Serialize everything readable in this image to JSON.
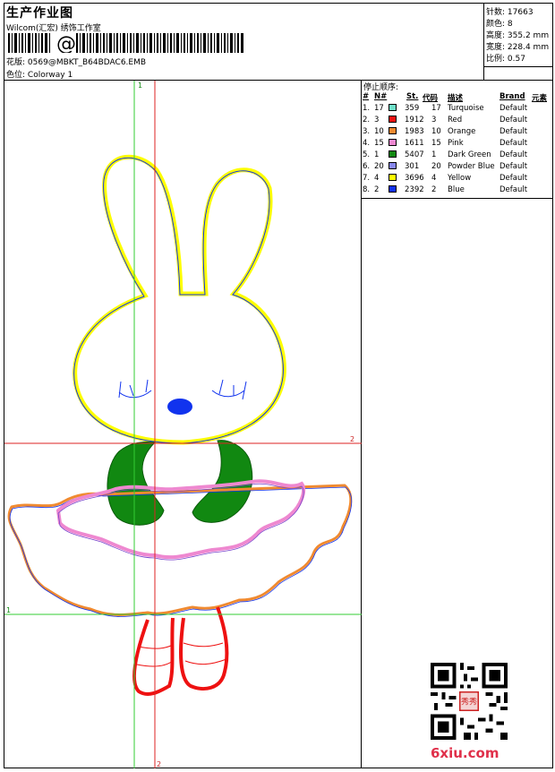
{
  "header": {
    "title": "生产作业图",
    "company": "Wilcom(汇宏) 绣饰工作室",
    "barcode_text": "@",
    "design_label": "花版:",
    "design_value": "0569@MBKT_B64BDAC6.EMB",
    "colorway_label": "色位:",
    "colorway_value": "Colorway 1"
  },
  "stats": {
    "stitches_label": "针数:",
    "stitches_value": "17663",
    "colors_label": "颜色:",
    "colors_value": "8",
    "height_label": "高度:",
    "height_value": "355.2 mm",
    "width_label": "宽度:",
    "width_value": "228.4 mm",
    "scale_label": "比例:",
    "scale_value": "0.57"
  },
  "guides": {
    "v1": "1",
    "v2": "2",
    "h1": "1",
    "h2": "2"
  },
  "stop_sequence": {
    "title": "停止顺序:",
    "columns": [
      "#",
      "N#",
      "St.",
      "代码",
      "描述",
      "Brand",
      "元素"
    ],
    "rows": [
      {
        "idx": "1.",
        "n": "17",
        "st": "359",
        "code": "17",
        "desc": "Turquoise",
        "brand": "Default",
        "color": "#6ee0c8"
      },
      {
        "idx": "2.",
        "n": "3",
        "st": "1912",
        "code": "3",
        "desc": "Red",
        "brand": "Default",
        "color": "#ee1111"
      },
      {
        "idx": "3.",
        "n": "10",
        "st": "1983",
        "code": "10",
        "desc": "Orange",
        "brand": "Default",
        "color": "#f08a30"
      },
      {
        "idx": "4.",
        "n": "15",
        "st": "1611",
        "code": "15",
        "desc": "Pink",
        "brand": "Default",
        "color": "#ee88d0"
      },
      {
        "idx": "5.",
        "n": "1",
        "st": "5407",
        "code": "1",
        "desc": "Dark Green",
        "brand": "Default",
        "color": "#118811"
      },
      {
        "idx": "6.",
        "n": "20",
        "st": "301",
        "code": "20",
        "desc": "Powder Blue",
        "brand": "Default",
        "color": "#8888ee"
      },
      {
        "idx": "7.",
        "n": "4",
        "st": "3696",
        "code": "4",
        "desc": "Yellow",
        "brand": "Default",
        "color": "#ffff00"
      },
      {
        "idx": "8.",
        "n": "2",
        "st": "2392",
        "code": "2",
        "desc": "Blue",
        "brand": "Default",
        "color": "#1133ee"
      }
    ]
  },
  "watermark": "6xiu.com",
  "qr_stamp": "秀秀"
}
